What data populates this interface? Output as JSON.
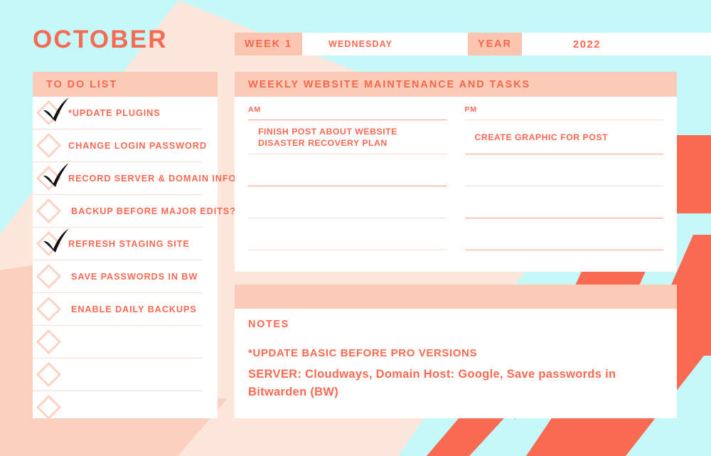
{
  "page": {
    "month": "OCTOBER"
  },
  "colors": {
    "coral_text": "#F96A52",
    "coral_dark": "#F4674C",
    "peach_band": "#FCCBB8",
    "peach_label": "#FCC5B0",
    "cyan_bg": "#C5F8F8",
    "coral_shape": "#F96A52",
    "pink_blob": "#FBD0BF",
    "soft_peach_bg": "#FDE6DC",
    "rule_light": "#FBDCD0",
    "rule_strong": "#F9A58E",
    "diamond_border": "#FBD3C4",
    "check_mark": "#111111"
  },
  "header": {
    "week_label": "WEEK 1",
    "week_value": "WEDNESDAY",
    "year_label": "YEAR",
    "year_value": "2022"
  },
  "todo": {
    "title": "TO DO LIST",
    "items": [
      {
        "label": "*UPDATE PLUGINS",
        "checked": true,
        "indent": false
      },
      {
        "label": "CHANGE LOGIN PASSWORD",
        "checked": false,
        "indent": false
      },
      {
        "label": "RECORD SERVER & DOMAIN INFO",
        "checked": true,
        "indent": false
      },
      {
        "label": "BACKUP BEFORE MAJOR EDITS?",
        "checked": false,
        "indent": true
      },
      {
        "label": "REFRESH STAGING SITE",
        "checked": true,
        "indent": false
      },
      {
        "label": "SAVE PASSWORDS IN BW",
        "checked": false,
        "indent": true
      },
      {
        "label": "ENABLE DAILY BACKUPS",
        "checked": false,
        "indent": true
      },
      {
        "label": "",
        "checked": false,
        "indent": false
      },
      {
        "label": "",
        "checked": false,
        "indent": false
      },
      {
        "label": "",
        "checked": false,
        "indent": false
      }
    ]
  },
  "tasks": {
    "title": "WEEKLY WEBSITE MAINTENANCE AND TASKS",
    "am": {
      "label": "AM",
      "lines": [
        "FINISH POST ABOUT WEBSITE DISASTER RECOVERY PLAN",
        "",
        "",
        ""
      ]
    },
    "pm": {
      "label": "PM",
      "lines": [
        "CREATE GRAPHIC FOR POST",
        "",
        "",
        ""
      ]
    }
  },
  "notes": {
    "title": "NOTES",
    "line_1": "*UPDATE BASIC BEFORE PRO VERSIONS",
    "line_2": "SERVER: Cloudways, Domain Host: Google, Save passwords in Bitwarden (BW)"
  }
}
